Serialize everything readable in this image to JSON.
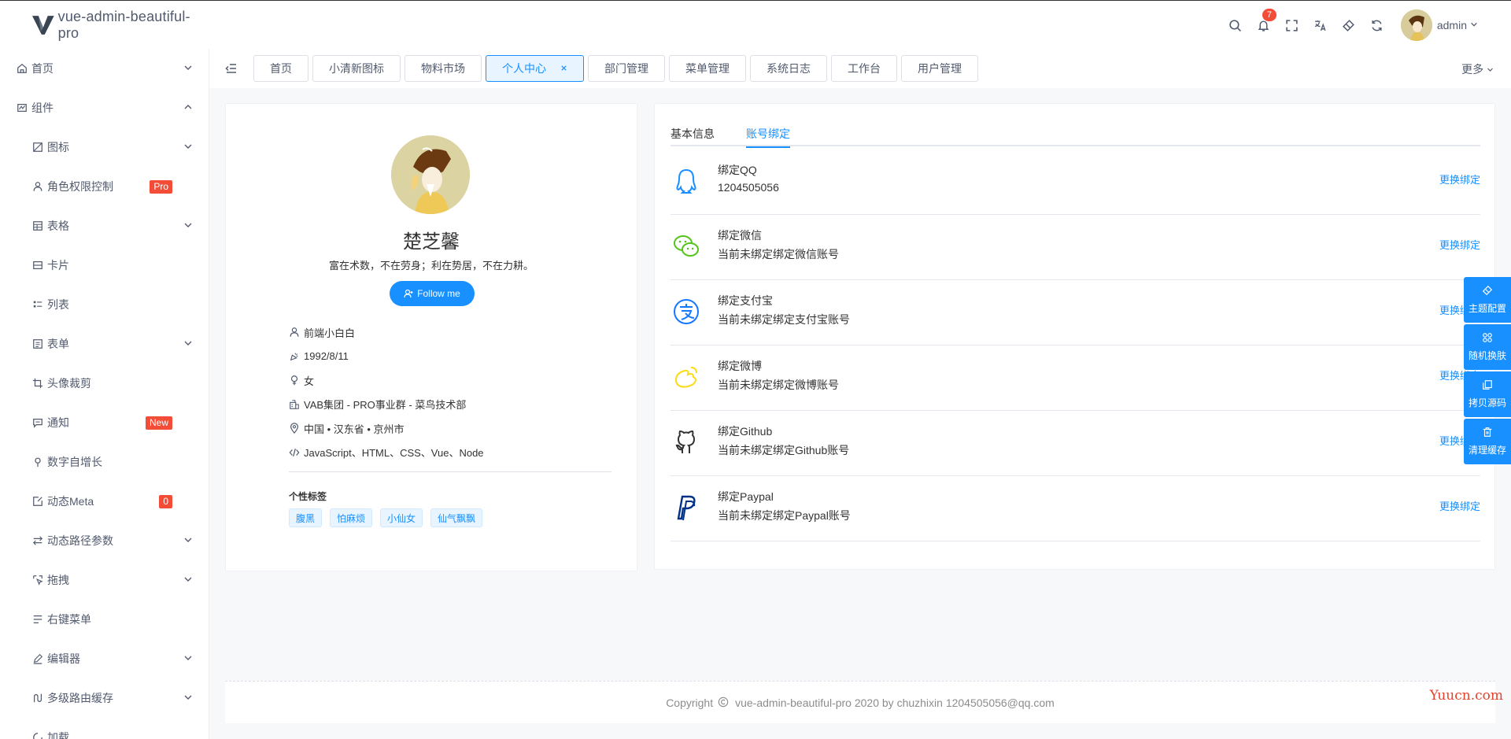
{
  "header": {
    "app_title": "vue-admin-beautiful-pro",
    "notifications_count": "7",
    "user_name": "admin"
  },
  "sidebar": {
    "items": [
      {
        "label": "首页",
        "icon": "home-icon",
        "level": 1,
        "arrow": "down"
      },
      {
        "label": "组件",
        "icon": "component-icon",
        "level": 1,
        "arrow": "up"
      },
      {
        "label": "图标",
        "icon": "picture-icon",
        "level": 2,
        "arrow": "down"
      },
      {
        "label": "角色权限控制",
        "icon": "user-icon",
        "level": 2,
        "badge": "Pro"
      },
      {
        "label": "表格",
        "icon": "table-icon",
        "level": 2,
        "arrow": "down"
      },
      {
        "label": "卡片",
        "icon": "card-icon",
        "level": 2
      },
      {
        "label": "列表",
        "icon": "list-icon",
        "level": 2
      },
      {
        "label": "表单",
        "icon": "form-icon",
        "level": 2,
        "arrow": "down"
      },
      {
        "label": "头像裁剪",
        "icon": "crop-icon",
        "level": 2
      },
      {
        "label": "通知",
        "icon": "message-icon",
        "level": 2,
        "badge": "New"
      },
      {
        "label": "数字自增长",
        "icon": "pin-icon",
        "level": 2
      },
      {
        "label": "动态Meta",
        "icon": "edit-box-icon",
        "level": 2,
        "badge": "0"
      },
      {
        "label": "动态路径参数",
        "icon": "arrows-icon",
        "level": 2,
        "arrow": "down"
      },
      {
        "label": "拖拽",
        "icon": "drag-icon",
        "level": 2,
        "arrow": "down"
      },
      {
        "label": "右键菜单",
        "icon": "menu-icon",
        "level": 2
      },
      {
        "label": "编辑器",
        "icon": "pencil-icon",
        "level": 2,
        "arrow": "down"
      },
      {
        "label": "多级路由缓存",
        "icon": "route-icon",
        "level": 2,
        "arrow": "down"
      },
      {
        "label": "加载",
        "icon": "loading-icon",
        "level": 2
      }
    ]
  },
  "tabs": {
    "items": [
      "首页",
      "小清新图标",
      "物料市场",
      "个人中心",
      "部门管理",
      "菜单管理",
      "系统日志",
      "工作台",
      "用户管理"
    ],
    "active_index": 3,
    "more_label": "更多"
  },
  "profile": {
    "name": "楚芝馨",
    "motto": "富在术数，不在劳身；利在势居，不在力耕。",
    "follow_label": "Follow me",
    "info": [
      {
        "icon": "user-icon",
        "text": "前端小白白"
      },
      {
        "icon": "birthday-icon",
        "text": "1992/8/11"
      },
      {
        "icon": "female-icon",
        "text": "女"
      },
      {
        "icon": "building-icon",
        "text": "VAB集团 - PRO事业群 - 菜鸟技术部"
      },
      {
        "icon": "location-icon",
        "text": "中国 • 汉东省 • 京州市"
      },
      {
        "icon": "code-icon",
        "text": "JavaScript、HTML、CSS、Vue、Node"
      }
    ],
    "tags_title": "个性标签",
    "tags": [
      "腹黑",
      "怕麻烦",
      "小仙女",
      "仙气飘飘"
    ]
  },
  "binding": {
    "tabs": [
      "基本信息",
      "账号绑定"
    ],
    "active_tab": 1,
    "items": [
      {
        "icon": "qq-icon",
        "title": "绑定QQ",
        "desc": "1204505056",
        "action": "更换绑定",
        "color": "#1890ff"
      },
      {
        "icon": "wechat-icon",
        "title": "绑定微信",
        "desc": "当前未绑定绑定微信账号",
        "action": "更换绑定",
        "color": "#52c41a"
      },
      {
        "icon": "alipay-icon",
        "title": "绑定支付宝",
        "desc": "当前未绑定绑定支付宝账号",
        "action": "更换绑定",
        "color": "#1677ff"
      },
      {
        "icon": "weibo-icon",
        "title": "绑定微博",
        "desc": "当前未绑定绑定微博账号",
        "action": "更换绑定",
        "color": "#fadb14"
      },
      {
        "icon": "github-icon",
        "title": "绑定Github",
        "desc": "当前未绑定绑定Github账号",
        "action": "更换绑定",
        "color": "#333333"
      },
      {
        "icon": "paypal-icon",
        "title": "绑定Paypal",
        "desc": "当前未绑定绑定Paypal账号",
        "action": "更换绑定",
        "color": "#003087"
      }
    ]
  },
  "float_bar": [
    {
      "icon": "brush-icon",
      "label": "主题配置"
    },
    {
      "icon": "apps-icon",
      "label": "随机换肤"
    },
    {
      "icon": "copy-icon",
      "label": "拷贝源码"
    },
    {
      "icon": "trash-icon",
      "label": "清理缓存"
    }
  ],
  "footer": {
    "prefix": "Copyright",
    "text": "vue-admin-beautiful-pro 2020 by chuzhixin 1204505056@qq.com"
  },
  "watermark": "Yuucn.com",
  "colors": {
    "primary": "#1890ff",
    "danger": "#f34d37"
  }
}
